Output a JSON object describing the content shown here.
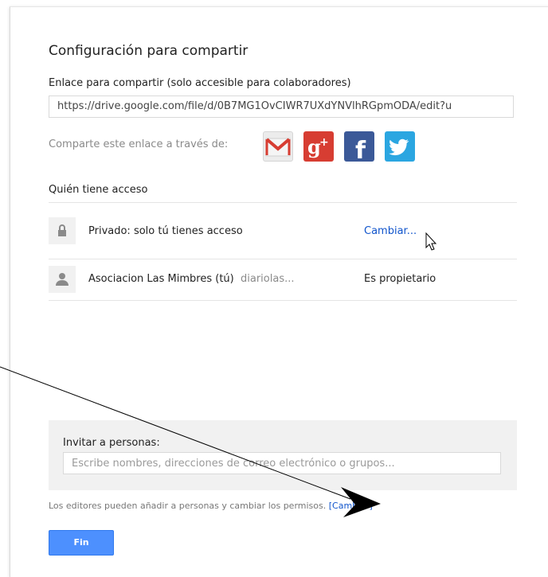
{
  "dialog": {
    "title": "Configuración para compartir",
    "link_label": "Enlace para compartir (solo accesible para colaboradores)",
    "link_value": "https://drive.google.com/file/d/0B7MG1OvCIWR7UXdYNVlhRGpmODA/edit?u",
    "share_via_label": "Comparte este enlace a través de:",
    "social": [
      {
        "name": "gmail-icon",
        "glyph": "M",
        "color": "#d73d32"
      },
      {
        "name": "google-plus-icon",
        "glyph": "g+",
        "color": "#d73d32"
      },
      {
        "name": "facebook-icon",
        "glyph": "f",
        "color": "#3b5998"
      },
      {
        "name": "twitter-icon",
        "glyph": "bird",
        "color": "#2ba6e1"
      }
    ],
    "access_heading": "Quién tiene acceso",
    "access_rows": [
      {
        "icon": "lock-icon",
        "text": "Privado: solo tú tienes acceso",
        "action": "Cambiar..."
      },
      {
        "icon": "person-icon",
        "name": "Asociacion Las Mimbres (tú)",
        "email": "diariolas...",
        "role": "Es propietario"
      }
    ],
    "invite": {
      "label": "Invitar a personas:",
      "placeholder": "Escribe nombres, direcciones de correo electrónico o grupos..."
    },
    "footnote": {
      "text": "Los editores pueden añadir a personas y cambiar los permisos.",
      "link": "[Cambiar]"
    },
    "done_button": "Fin"
  },
  "colors": {
    "link": "#1155cc",
    "primary_button": "#4d90fe",
    "panel_bg": "#f1f1f1"
  }
}
